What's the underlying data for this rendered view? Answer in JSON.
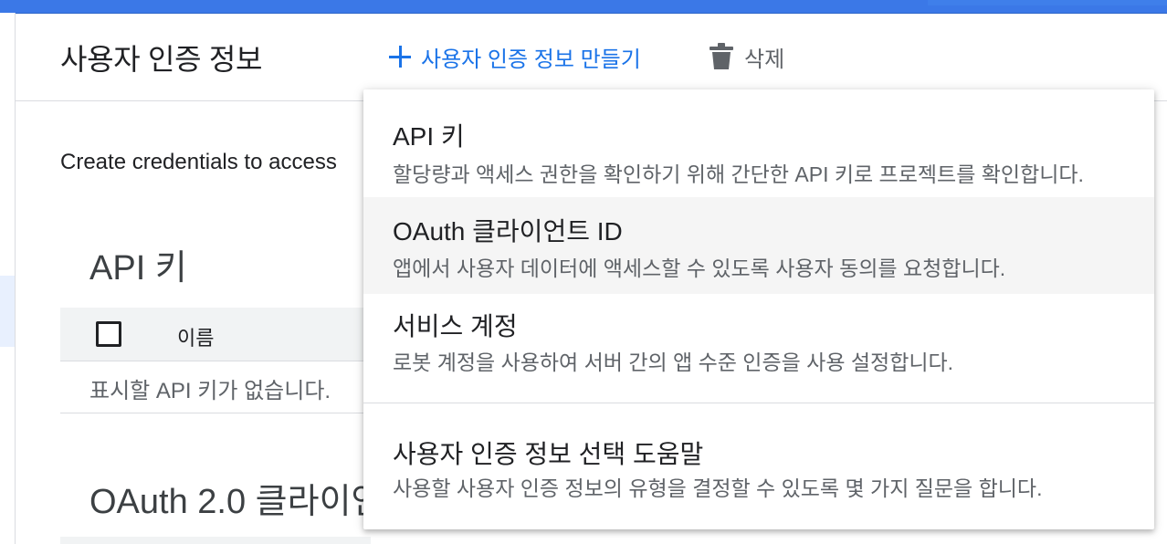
{
  "header": {
    "title": "사용자 인증 정보",
    "create_label": "사용자 인증 정보 만들기",
    "delete_label": "삭제"
  },
  "main": {
    "intro": "Create credentials to access",
    "api_keys_title": "API 키",
    "table": {
      "columns": [
        "이름"
      ]
    },
    "empty_message": "표시할 API 키가 없습니다.",
    "oauth_title": "OAuth 2.0 클라이언"
  },
  "dropdown": {
    "items": [
      {
        "title": "API 키",
        "desc": "할당량과 액세스 권한을 확인하기 위해 간단한 API 키로 프로젝트를 확인합니다."
      },
      {
        "title": "OAuth 클라이언트 ID",
        "desc": "앱에서 사용자 데이터에 액세스할 수 있도록 사용자 동의를 요청합니다."
      },
      {
        "title": "서비스 계정",
        "desc": "로봇 계정을 사용하여 서버 간의 앱 수준 인증을 사용 설정합니다."
      },
      {
        "title": "사용자 인증 정보 선택 도움말",
        "desc": "사용할 사용자 인증 정보의 유형을 결정할 수 있도록 몇 가지 질문을 합니다."
      }
    ]
  },
  "colors": {
    "brand": "#3b78e7",
    "link": "#1a73e8",
    "hover_bg": "#f5f5f5"
  },
  "icons": {
    "create": "plus-icon",
    "delete": "trash-icon"
  }
}
